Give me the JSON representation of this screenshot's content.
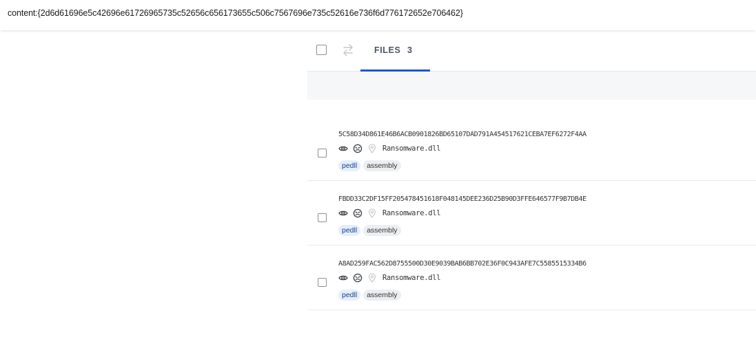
{
  "header": {
    "content": "content:{2d6d61696e5c42696e61726965735c52656c656173655c506c7567696e735c52616e736f6d776172652e706462}"
  },
  "toolbar": {
    "tab_label": "FILES",
    "tab_count": "3",
    "accent_color": "#1a56db"
  },
  "files": [
    {
      "hash": "5C58D34D861E46B6ACB0901826BD65107DAD791A454517621CEBA7EF6272F4AA",
      "name": "Ransomware.dll",
      "tags": [
        "pedll",
        "assembly"
      ]
    },
    {
      "hash": "FBDD33C2DF15FF205478451618F048145DEE236D25B90D3FFE646577F9B7DB4E",
      "name": "Ransomware.dll",
      "tags": [
        "pedll",
        "assembly"
      ]
    },
    {
      "hash": "A8AD259FAC562D8755500D30E9039BAB6BB702E36F0C943AFE7C5585515334B6",
      "name": "Ransomware.dll",
      "tags": [
        "pedll",
        "assembly"
      ]
    }
  ],
  "icons": {
    "detections": "eye-icon",
    "sandbox": "bug-icon",
    "location": "location-pin-icon",
    "compare": "swap-arrows-icon"
  }
}
